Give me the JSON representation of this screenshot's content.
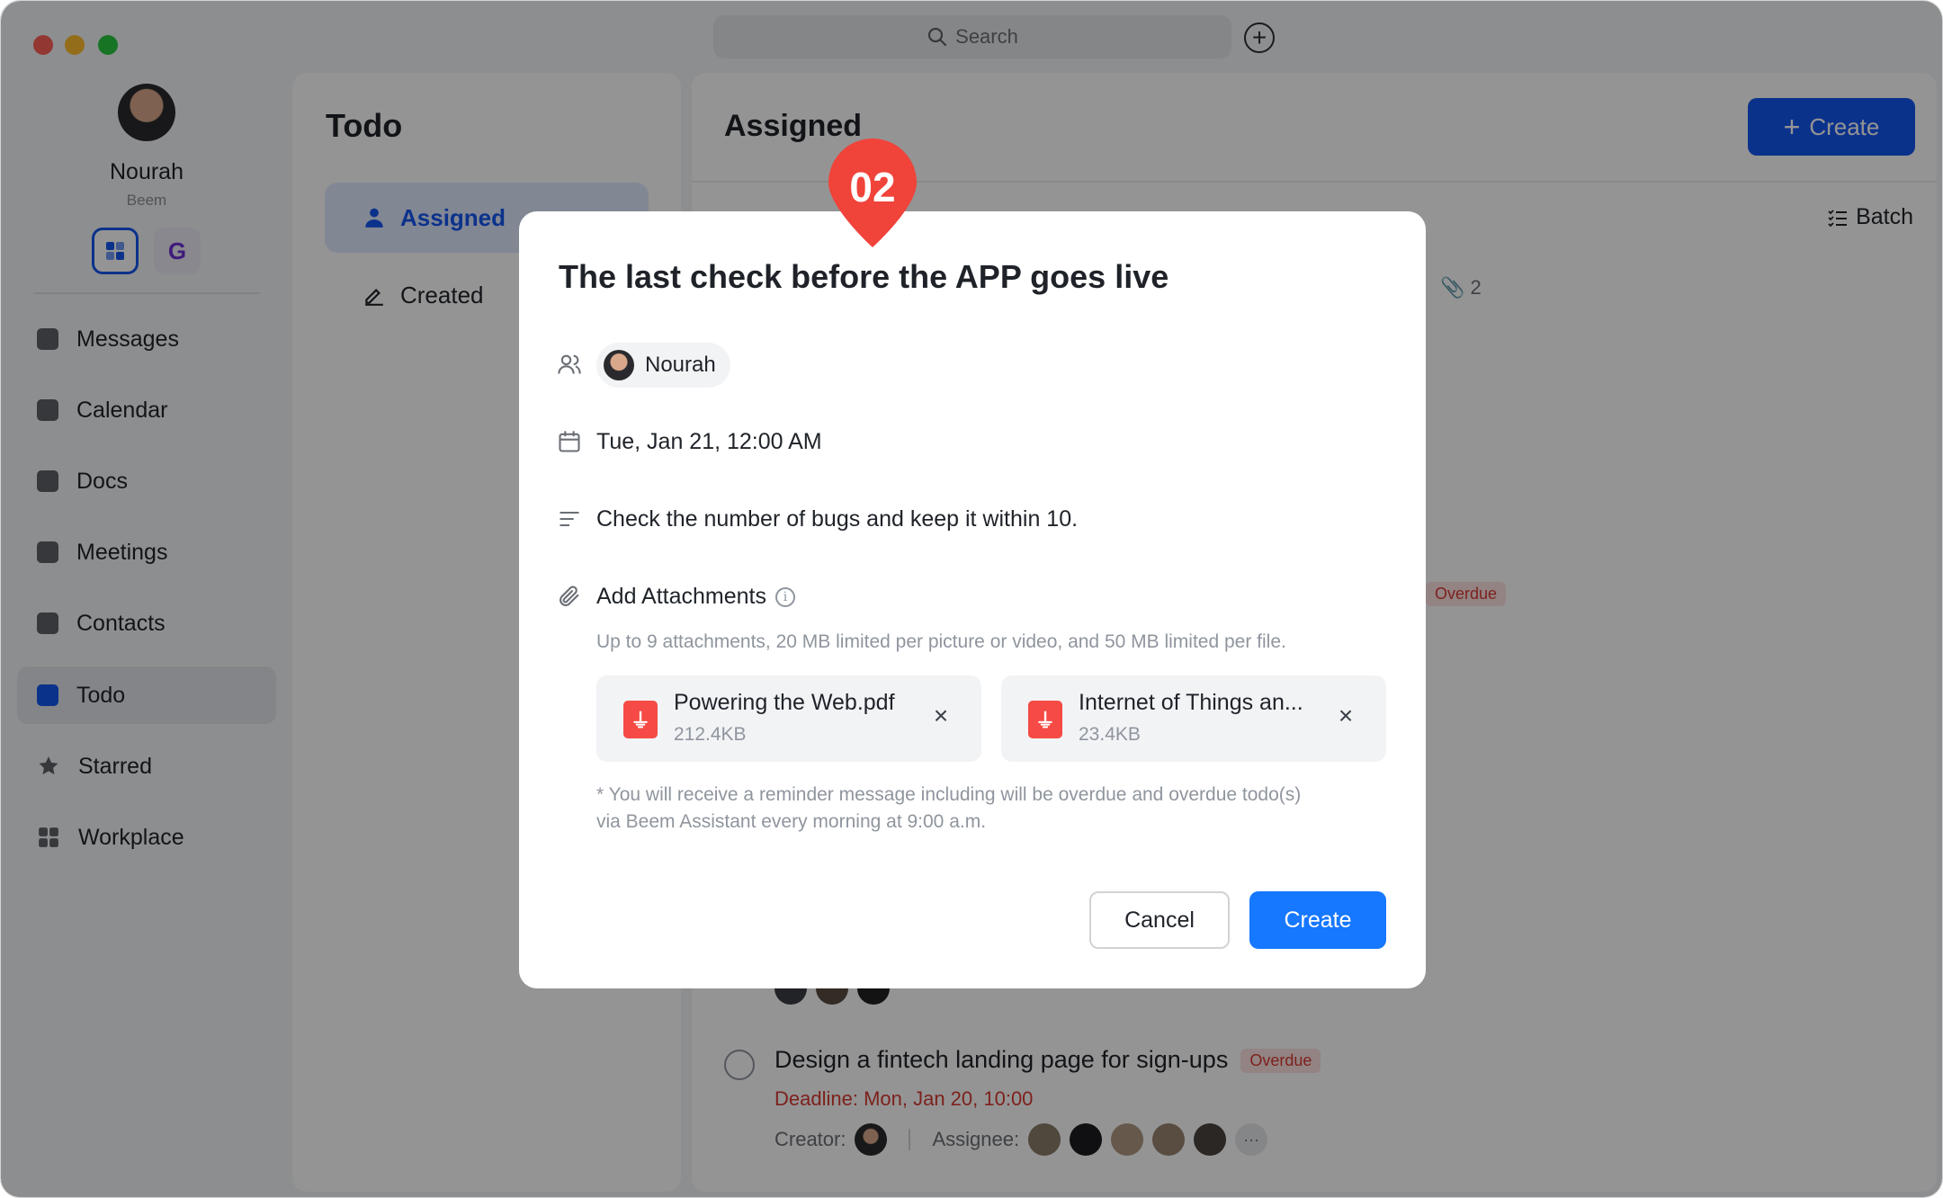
{
  "search": {
    "label": "Search"
  },
  "user": {
    "name": "Nourah",
    "org": "Beem"
  },
  "workspaces": [
    {
      "label": ""
    },
    {
      "label": "G"
    }
  ],
  "nav": {
    "items": [
      {
        "label": "Messages",
        "icon": "chat-icon"
      },
      {
        "label": "Calendar",
        "icon": "calendar-icon"
      },
      {
        "label": "Docs",
        "icon": "docs-icon"
      },
      {
        "label": "Meetings",
        "icon": "video-icon"
      },
      {
        "label": "Contacts",
        "icon": "contacts-icon"
      },
      {
        "label": "Todo",
        "icon": "todo-icon",
        "active": true
      },
      {
        "label": "Starred",
        "icon": "star-icon"
      },
      {
        "label": "Workplace",
        "icon": "apps-grid-icon"
      }
    ]
  },
  "todo": {
    "title": "Todo",
    "tabs": [
      {
        "label": "Assigned",
        "active": true
      },
      {
        "label": "Created"
      }
    ]
  },
  "main": {
    "title": "Assigned",
    "create_label": "Create",
    "batch_label": "Batch",
    "attach_count": "2",
    "overdue_label": "Overdue",
    "task": {
      "title": "Design a fintech landing page for sign-ups",
      "badge": "Overdue",
      "deadline": "Deadline: Mon, Jan 20, 10:00",
      "creator_label": "Creator:",
      "assignee_label": "Assignee:"
    }
  },
  "marker": {
    "label": "02"
  },
  "modal": {
    "title": "The last check before the APP goes live",
    "assignee": "Nourah",
    "date": "Tue, Jan 21, 12:00 AM",
    "description": "Check the number of bugs and keep it within 10.",
    "attachments_label": "Add Attachments",
    "attachments_hint": "Up to 9 attachments, 20 MB limited per picture or video, and 50 MB limited per file.",
    "files": [
      {
        "name": "Powering the Web.pdf",
        "size": "212.4KB"
      },
      {
        "name": "Internet of Things an...",
        "size": "23.4KB"
      }
    ],
    "reminder_line1": "* You will receive a reminder message including will be overdue and overdue todo(s)",
    "reminder_line2": "via Beem Assistant every morning at 9:00 a.m.",
    "cancel_label": "Cancel",
    "create_label": "Create"
  },
  "colors": {
    "accent": "#1456f0",
    "create_button": "#1677ff",
    "overdue": "#d83931",
    "marker": "#f0433a"
  }
}
